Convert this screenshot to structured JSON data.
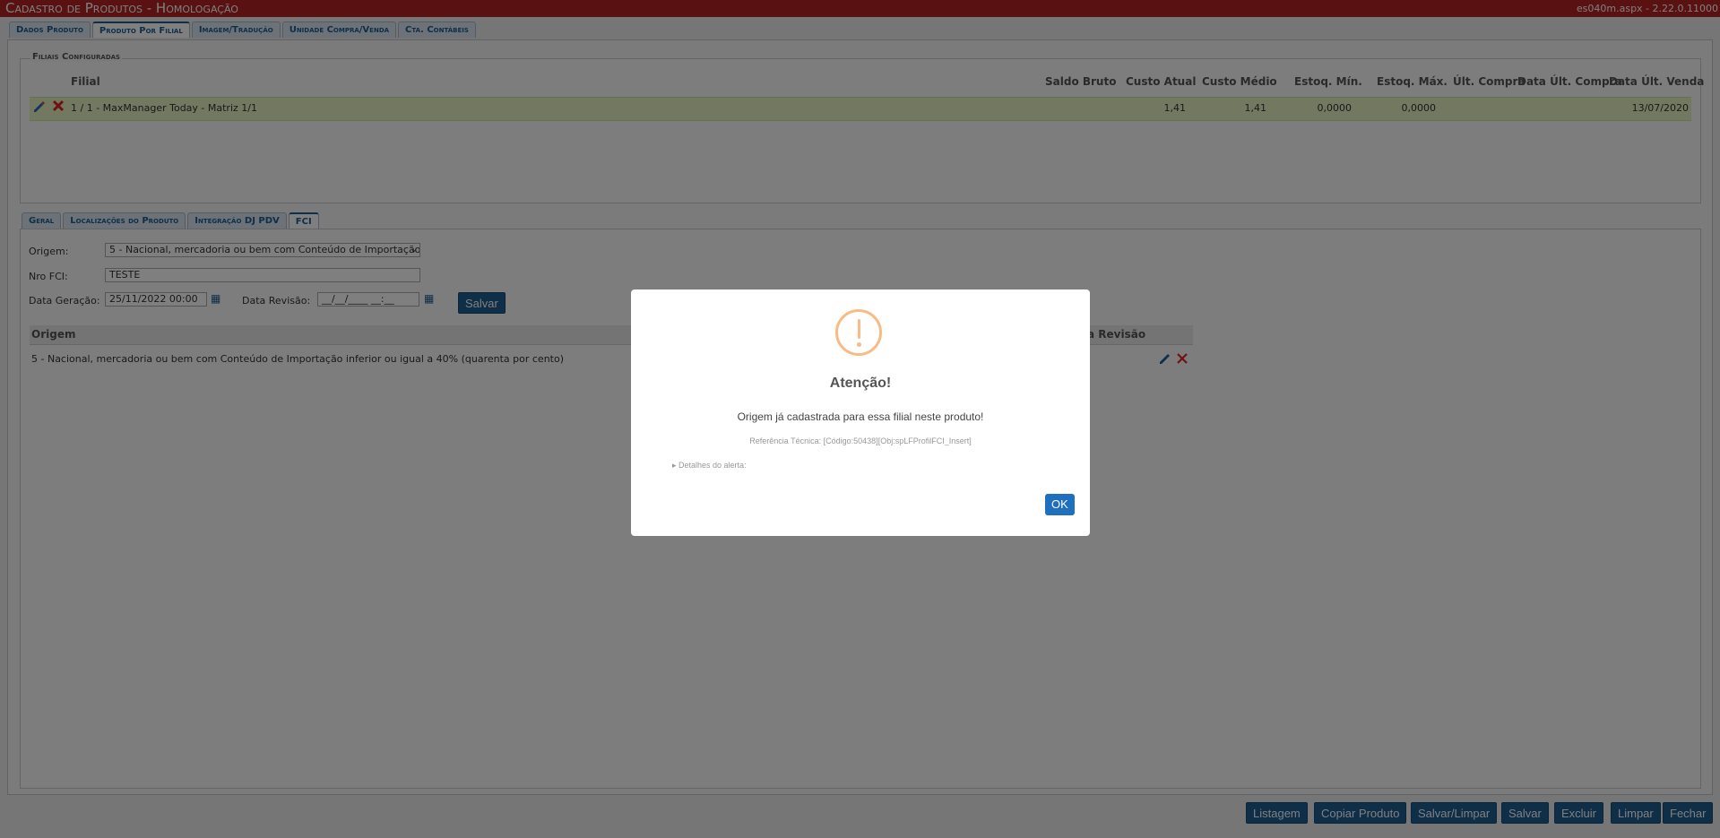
{
  "titlebar": {
    "title": "Cadastro de Produtos  - Homologação",
    "version": "es040m.aspx - 2.22.0.11000"
  },
  "main_tabs": [
    {
      "label": "Dados Produto"
    },
    {
      "label": "Produto Por Filial",
      "active": true
    },
    {
      "label": "Imagem/Tradução"
    },
    {
      "label": "Unidade Compra/Venda"
    },
    {
      "label": "Cta. Contábeis"
    }
  ],
  "filiais": {
    "legend": "Filiais Configuradas",
    "columns": [
      "Filial",
      "Saldo Bruto",
      "Custo Atual",
      "Custo Médio",
      "Estoq. Mín.",
      "Estoq. Máx.",
      "Últ. Compra",
      "Data Últ. Compra",
      "Data Últ. Venda"
    ],
    "row": {
      "filial": "1 / 1 - MaxManager Today - Matriz 1/1",
      "saldo_bruto": "",
      "custo_atual": "1,41",
      "custo_medio": "1,41",
      "estoq_min": "0,0000",
      "estoq_max": "0,0000",
      "ult_compra": "",
      "data_ult_compra": "",
      "data_ult_venda": "13/07/2020"
    }
  },
  "sub_tabs": [
    {
      "label": "Geral"
    },
    {
      "label": "Localizações do Produto"
    },
    {
      "label": "Integração DJ PDV"
    },
    {
      "label": "FCI",
      "active": true
    }
  ],
  "fci_form": {
    "origem_label": "Origem:",
    "origem_value": "5 - Nacional, mercadoria ou bem com Conteúdo de Importação",
    "nro_label": "Nro FCI:",
    "nro_value": "TESTE",
    "data_geracao_label": "Data Geração:",
    "data_geracao_value": "25/11/2022 00:00",
    "data_revisao_label": "Data Revisão:",
    "data_revisao_value": "__/__/____ __:__",
    "salvar_label": "Salvar"
  },
  "fci_table": {
    "col_origem": "Origem",
    "col_revisao_partial": "a Revisão",
    "row_origem": "5 - Nacional, mercadoria ou bem com Conteúdo de Importação inferior ou igual a 40% (quarenta por cento)"
  },
  "bottom_buttons": [
    "Listagem",
    "Copiar Produto",
    "Salvar/Limpar",
    "Salvar",
    "Excluir",
    "Limpar",
    "Fechar"
  ],
  "modal": {
    "title": "Atenção!",
    "message": "Origem já cadastrada para essa filial neste produto!",
    "reference": "Referência Técnica: [Código:50438][Obj:spLFProfilFCI_Insert]",
    "details": "▸ Detalhes do alerta:",
    "ok_label": "OK",
    "icon": "warning-exclamation-icon",
    "icon_color": "#f8bb86"
  }
}
